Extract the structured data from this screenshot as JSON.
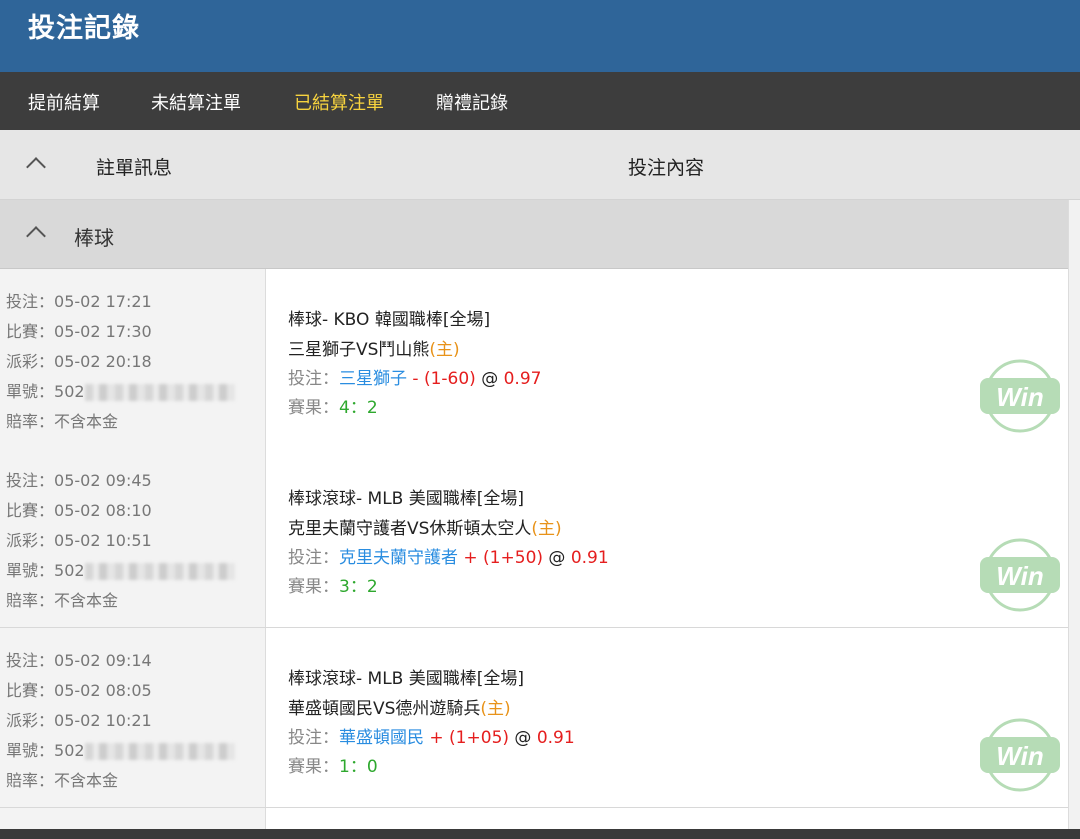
{
  "header": {
    "title": "投注記錄"
  },
  "tabs": [
    {
      "label": "提前結算"
    },
    {
      "label": "未結算注單"
    },
    {
      "label": "已結算注單"
    },
    {
      "label": "贈禮記錄"
    }
  ],
  "columns": {
    "info": "註單訊息",
    "content": "投注內容"
  },
  "section": {
    "label": "棒球"
  },
  "labels": {
    "bet_time": "投注：",
    "match_time": "比賽：",
    "payout_time": "派彩：",
    "ticket_no": "單號：",
    "odds_type": "賠率：",
    "bet": "投注：",
    "result": "賽果：",
    "at": "@"
  },
  "colors": {
    "header": "#2f6599",
    "tab_bar": "#3d3d3d",
    "tab_active": "#f7d33e",
    "team": "#2a8de0",
    "handicap": "#e51e1e",
    "result": "#2ea82e",
    "home": "#e8931a",
    "win_badge": "#b6dcb6"
  },
  "bets": [
    {
      "bet_time": "05-02 17:21",
      "match_time": "05-02 17:30",
      "payout_time": "05-02 20:18",
      "ticket_prefix": "502",
      "odds_type": "不含本金",
      "league": "棒球- KBO 韓國職棒[全場]",
      "match": "三星獅子VS鬥山熊",
      "home_tag": "(主)",
      "pick": "三星獅子",
      "handicap": "- (1-60)",
      "odds": "0.97",
      "score": "4：2",
      "badge": "Win"
    },
    {
      "bet_time": "05-02 09:45",
      "match_time": "05-02 08:10",
      "payout_time": "05-02 10:51",
      "ticket_prefix": "502",
      "odds_type": "不含本金",
      "league": "棒球滾球- MLB 美國職棒[全場]",
      "match": "克里夫蘭守護者VS休斯頓太空人",
      "home_tag": "(主)",
      "pick": "克里夫蘭守護者",
      "handicap": "+ (1+50)",
      "odds": "0.91",
      "score": "3：2",
      "badge": "Win"
    },
    {
      "bet_time": "05-02 09:14",
      "match_time": "05-02 08:05",
      "payout_time": "05-02 10:21",
      "ticket_prefix": "502",
      "odds_type": "不含本金",
      "league": "棒球滾球- MLB 美國職棒[全場]",
      "match": "華盛頓國民VS德州遊騎兵",
      "home_tag": "(主)",
      "pick": "華盛頓國民",
      "handicap": "+ (1+05)",
      "odds": "0.91",
      "score": "1：0",
      "badge": "Win"
    }
  ]
}
